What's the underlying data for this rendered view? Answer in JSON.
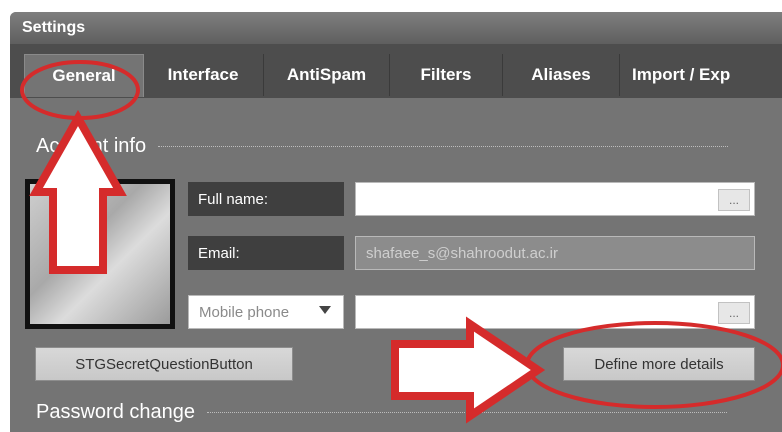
{
  "window": {
    "title": "Settings"
  },
  "tabs": [
    {
      "label": "General",
      "active": true
    },
    {
      "label": "Interface"
    },
    {
      "label": "AntiSpam"
    },
    {
      "label": "Filters"
    },
    {
      "label": "Aliases"
    },
    {
      "label": "Import / Exp"
    }
  ],
  "account_info": {
    "heading": "Account info",
    "fields": {
      "full_name": {
        "label": "Full name:",
        "value": ""
      },
      "email": {
        "label": "Email:",
        "value": "shafaee_s@shahroodut.ac.ir"
      },
      "mobile": {
        "selected": "Mobile phone",
        "value": ""
      }
    },
    "ellipsis": "..."
  },
  "buttons": {
    "secret_question": "STGSecretQuestionButton",
    "define_more": "Define more details"
  },
  "password_change": {
    "heading": "Password change"
  },
  "colors": {
    "annotation": "#d52b2b"
  },
  "icons": {
    "avatar": "avatar-image",
    "chevron": "chevron-down-icon",
    "arrow_up": "annotation-arrow-up-icon",
    "arrow_right": "annotation-arrow-right-icon"
  }
}
